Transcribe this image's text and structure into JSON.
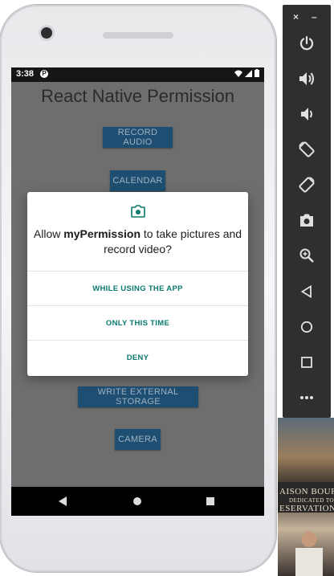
{
  "status_bar": {
    "time": "3:38",
    "app_badge": "P"
  },
  "app": {
    "title": "React Native Permission",
    "buttons": {
      "record_audio": "RECORD AUDIO",
      "calendar": "CALENDAR",
      "write_external_storage": "WRITE EXTERNAL STORAGE",
      "camera": "CAMERA"
    },
    "button_color": "#1e4f72"
  },
  "dialog": {
    "icon": "camera-icon",
    "message_prefix": "Allow ",
    "message_app": "myPermission",
    "message_suffix": " to take pictures and record video?",
    "options": {
      "while_using": "WHILE USING THE APP",
      "only_this_time": "ONLY THIS TIME",
      "deny": "DENY"
    },
    "accent_color": "#0b7a6f"
  },
  "nav_bar": {
    "icons": [
      "back-icon",
      "home-icon",
      "recents-icon"
    ]
  },
  "emulator_toolbar": {
    "close": "×",
    "minimize": "–",
    "buttons": [
      "power-icon",
      "volume-up-icon",
      "volume-down-icon",
      "rotate-left-icon",
      "rotate-right-icon",
      "screenshot-icon",
      "zoom-icon",
      "back-icon",
      "home-icon",
      "overview-icon",
      "more-icon"
    ]
  },
  "background_sign": {
    "line1": "AISON BOUR",
    "line2": "DEDICATED TO",
    "line3": "ESERVATION"
  }
}
